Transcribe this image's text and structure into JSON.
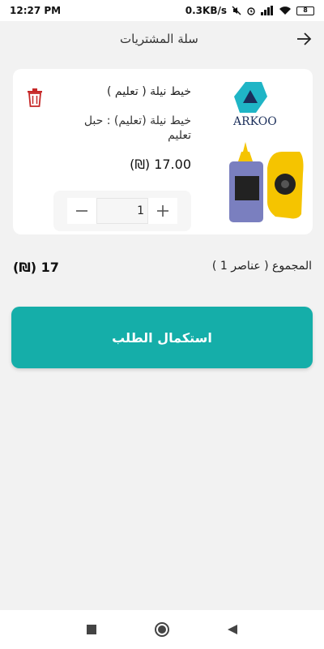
{
  "status_bar": {
    "time": "12:27 PM",
    "network_speed": "0.3KB/s",
    "battery_level": "8"
  },
  "header": {
    "title": "سلة المشتريات",
    "back_icon": "arrow-right-icon"
  },
  "cart_item": {
    "brand": "ARKOO",
    "name": "خيط نيلة ( تعليم )",
    "description": "خيط نيلة (تعليم) : حبل تعليم",
    "price": "(₪) 17.00",
    "quantity": "1"
  },
  "summary": {
    "total_label": "المجموع ( عناصر 1 )",
    "total_value": "(₪) 17"
  },
  "checkout": {
    "label": "استكمال الطلب"
  },
  "colors": {
    "accent": "#15aea9",
    "delete": "#c62828",
    "background": "#f2f2f2"
  }
}
